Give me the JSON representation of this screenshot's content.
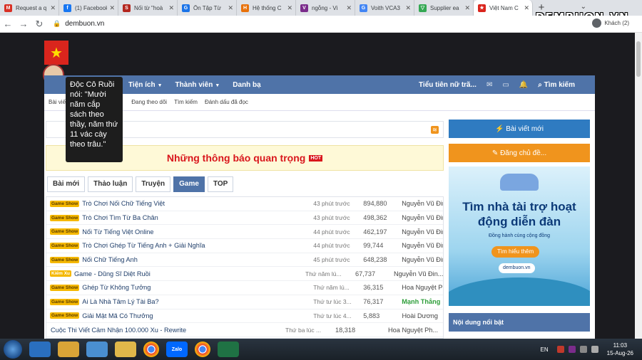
{
  "browser": {
    "tabs": [
      {
        "title": "Request a q",
        "color": "#d93025",
        "glyph": "M"
      },
      {
        "title": "(1) Facebook",
        "color": "#1877f2",
        "glyph": "f"
      },
      {
        "title": "Nối từ \"hoà",
        "color": "#b3261e",
        "glyph": "S"
      },
      {
        "title": "Ôn Tập Từ",
        "color": "#1a73e8",
        "glyph": "G"
      },
      {
        "title": "Hệ thống C",
        "color": "#e8710a",
        "glyph": "H"
      },
      {
        "title": "ngỗng - Vi",
        "color": "#7b2c8b",
        "glyph": "V"
      },
      {
        "title": "Voith VCA3",
        "color": "#4285f4",
        "glyph": "G"
      },
      {
        "title": "Supplier ea",
        "color": "#34a853",
        "glyph": "▽"
      },
      {
        "title": "Việt Nam C",
        "color": "#da251d",
        "glyph": "★"
      }
    ],
    "brand_overlay": "DEMBUON.VN",
    "url": "dembuon.vn",
    "guest_label": "Khách (2)"
  },
  "tooltip": {
    "text": "Độc Cô Ruồi nói: \"Mười năm cắp sách theo thầy, năm thứ 11 vác cày theo trâu.\""
  },
  "navbar": {
    "items": [
      "Tiện ích",
      "Thành viên",
      "Danh bạ"
    ],
    "right_items": [
      "Tiểu tiên nữ trã...",
      "Tìm kiếm"
    ]
  },
  "subnav": {
    "items": [
      "Bài viết",
      "Đang theo dõi",
      "Tìm kiếm",
      "Đánh dấu đã đọc"
    ]
  },
  "notice": {
    "title": "Những thông báo quan trọng",
    "badge": "HOT"
  },
  "content_tabs": {
    "items": [
      "Bài mới",
      "Thảo luận",
      "Truyện",
      "Game",
      "TOP"
    ],
    "active": "Game"
  },
  "threads": [
    {
      "tag": "Game Show",
      "title": "Trò Chơi Nối Chữ Tiếng Việt",
      "time": "43 phút trước",
      "views": "894,880",
      "user": "Nguyễn Vũ Đin..."
    },
    {
      "tag": "Game Show",
      "title": "Trò Chơi Tìm Từ Ba Chân",
      "time": "43 phút trước",
      "views": "498,362",
      "user": "Nguyễn Vũ Đin..."
    },
    {
      "tag": "Game Show",
      "title": "Nối Từ Tiếng Việt Online",
      "time": "44 phút trước",
      "views": "462,197",
      "user": "Nguyễn Vũ Đin..."
    },
    {
      "tag": "Game Show",
      "title": "Trò Chơi Ghép Từ Tiếng Anh + Giải Nghĩa",
      "time": "44 phút trước",
      "views": "99,744",
      "user": "Nguyễn Vũ Đin..."
    },
    {
      "tag": "Game Show",
      "title": "Nối Chữ Tiếng Anh",
      "time": "45 phút trước",
      "views": "648,238",
      "user": "Nguyễn Vũ Đin..."
    },
    {
      "tag": "Kiếm Xu",
      "title": "Game - Dũng Sĩ Diệt Ruồi",
      "time": "Thứ năm lú...",
      "views": "67,737",
      "user": "Nguyễn Vũ Đin..."
    },
    {
      "tag": "Game Show",
      "title": "Ghép Từ Không Tưởng",
      "time": "Thứ năm lú...",
      "views": "36,315",
      "user": "Hoa Nguyệt Ph..."
    },
    {
      "tag": "Game Show",
      "title": "Ai Là Nhà Tâm Lý Tài Ba?",
      "time": "Thứ tư lúc 3...",
      "views": "76,317",
      "user": "Mạnh Thắng",
      "user_color": "#2e9e3a"
    },
    {
      "tag": "Game Show",
      "title": "Giải Mật Mã Có Thưởng",
      "time": "Thứ tư lúc 4...",
      "views": "5,883",
      "user": "Hoài Dương"
    },
    {
      "tag": "",
      "title": "Cuộc Thi Viết Cảm Nhận 100.000 Xu - Rewrite",
      "time": "Thứ ba lúc ...",
      "views": "18,318",
      "user": "Hoa Nguyệt Ph..."
    }
  ],
  "sidebar": {
    "new_post": "Bài viết mới",
    "register": "Đăng chủ đề...",
    "banner_title": "Tìm nhà tài trợ hoạt động diễn đàn",
    "banner_sub": "Đồng hành cùng cộng đồng",
    "banner_cta": "Tìm hiểu thêm",
    "banner_site": "dembuon.vn",
    "featured": "Nội dung nổi bật"
  },
  "taskbar": {
    "apps": [
      "IE",
      "Folder",
      "Docs",
      "Explorer",
      "Chrome",
      "Zalo",
      "Chrome",
      "Excel"
    ],
    "lang": "EN",
    "time": "11:03",
    "date": "15-Aug-26"
  },
  "colors": {
    "nav_blue": "#4f73a8",
    "hot_red": "#d9161c",
    "tag_gold": "#f5b800",
    "orange": "#f0941d"
  }
}
